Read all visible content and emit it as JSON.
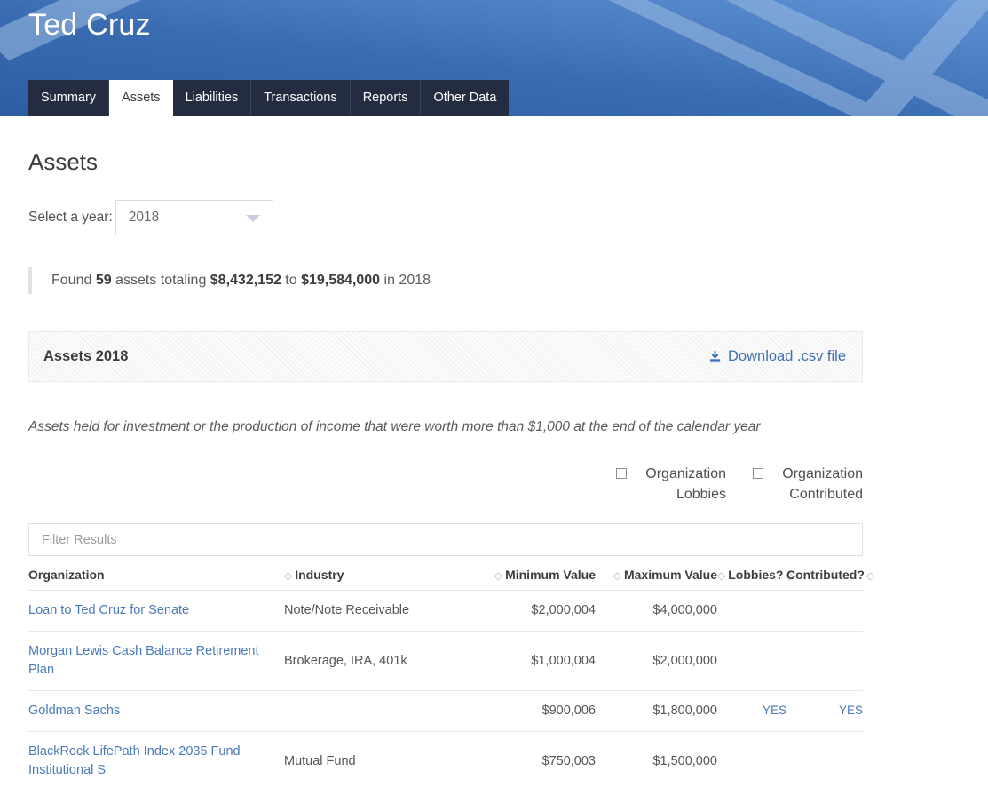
{
  "header": {
    "person_name": "Ted Cruz",
    "brand_blue": "#3466ad",
    "tab_navy": "#242c42",
    "tabs": [
      {
        "label": "Summary",
        "active": false
      },
      {
        "label": "Assets",
        "active": true
      },
      {
        "label": "Liabilities",
        "active": false
      },
      {
        "label": "Transactions",
        "active": false
      },
      {
        "label": "Reports",
        "active": false
      },
      {
        "label": "Other Data",
        "active": false
      }
    ]
  },
  "main": {
    "page_title": "Assets",
    "year_select": {
      "label": "Select a year:",
      "value": "2018",
      "caret_icon": "chevron-down-icon"
    },
    "summary": {
      "prefix": "Found ",
      "count": "59",
      "mid1": " assets totaling ",
      "min_total": "$8,432,152",
      "mid2": " to ",
      "max_total": "$19,584,000",
      "suffix": " in 2018"
    },
    "panel": {
      "title": "Assets 2018",
      "download_label": "Download .csv file",
      "download_icon": "download-icon",
      "link_color": "#3d6fb4"
    },
    "note": "Assets held for investment or the production of income that were worth more than $1,000 at the end of the calendar year",
    "checkboxes": [
      {
        "label": "Organization Lobbies",
        "checked": false
      },
      {
        "label": "Organization Contributed",
        "checked": false
      }
    ],
    "filter": {
      "placeholder": "Filter Results",
      "value": ""
    },
    "table": {
      "sort_icon": "sort-updown-icon",
      "columns": [
        {
          "key": "organization",
          "label": "Organization",
          "sortable": false,
          "sort_icon_position": "none"
        },
        {
          "key": "industry",
          "label": "Industry",
          "sortable": true,
          "sort_icon_position": "before"
        },
        {
          "key": "minimum_value",
          "label": "Minimum Value",
          "sortable": true,
          "sort_icon_position": "before"
        },
        {
          "key": "maximum_value",
          "label": "Maximum Value",
          "sortable": true,
          "sort_icon_position": "before"
        },
        {
          "key": "lobbies",
          "label": "Lobbies?",
          "sortable": true,
          "sort_icon_position": "both"
        },
        {
          "key": "contributed",
          "label": "Contributed?",
          "sortable": true,
          "sort_icon_position": "after"
        }
      ],
      "rows": [
        {
          "organization": "Loan to Ted Cruz for Senate",
          "industry": "Note/Note Receivable",
          "minimum_value": "$2,000,004",
          "maximum_value": "$4,000,000",
          "lobbies": "",
          "contributed": ""
        },
        {
          "organization": "Morgan Lewis Cash Balance Retirement Plan",
          "industry": "Brokerage, IRA, 401k",
          "minimum_value": "$1,000,004",
          "maximum_value": "$2,000,000",
          "lobbies": "",
          "contributed": ""
        },
        {
          "organization": "Goldman Sachs",
          "industry": "",
          "minimum_value": "$900,006",
          "maximum_value": "$1,800,000",
          "lobbies": "YES",
          "contributed": "YES"
        },
        {
          "organization": "BlackRock LifePath Index 2035 Fund Institutional S",
          "industry": "Mutual Fund",
          "minimum_value": "$750,003",
          "maximum_value": "$1,500,000",
          "lobbies": "",
          "contributed": ""
        }
      ]
    }
  }
}
